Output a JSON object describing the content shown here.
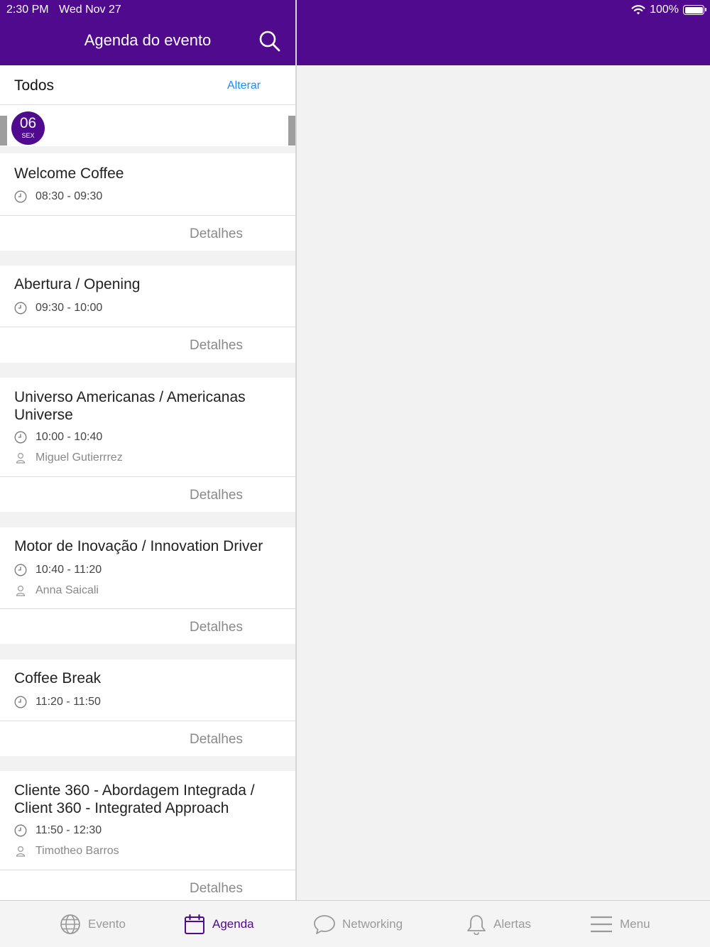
{
  "status_bar": {
    "time": "2:30 PM",
    "date": "Wed Nov 27",
    "battery": "100%"
  },
  "header": {
    "title": "Agenda do evento"
  },
  "filter": {
    "label": "Todos",
    "change_label": "Alterar"
  },
  "date_selector": {
    "day": "06",
    "weekday": "SEX"
  },
  "sessions": [
    {
      "title": "Welcome Coffee",
      "time": "08:30 - 09:30",
      "speaker": "",
      "details_label": "Detalhes"
    },
    {
      "title": "Abertura / Opening",
      "time": "09:30 - 10:00",
      "speaker": "",
      "details_label": "Detalhes"
    },
    {
      "title": "Universo Americanas / Americanas Universe",
      "time": "10:00 - 10:40",
      "speaker": "Miguel Gutierrrez",
      "details_label": "Detalhes"
    },
    {
      "title": "Motor de Inovação / Innovation Driver",
      "time": "10:40 - 11:20",
      "speaker": "Anna Saicali",
      "details_label": "Detalhes"
    },
    {
      "title": "Coffee Break",
      "time": "11:20 - 11:50",
      "speaker": "",
      "details_label": "Detalhes"
    },
    {
      "title": "Cliente 360 - Abordagem Integrada / Client 360 - Integrated Approach",
      "time": "11:50 - 12:30",
      "speaker": "Timotheo Barros",
      "details_label": "Detalhes"
    }
  ],
  "tabbar": {
    "items": [
      {
        "label": "Evento",
        "icon": "globe-icon"
      },
      {
        "label": "Agenda",
        "icon": "calendar-icon"
      },
      {
        "label": "Networking",
        "icon": "chat-bubble-icon"
      },
      {
        "label": "Alertas",
        "icon": "bell-icon"
      },
      {
        "label": "Menu",
        "icon": "menu-icon"
      }
    ],
    "active": "Agenda",
    "active_color": "#4f0a8e"
  },
  "colors": {
    "brand": "#4f0a8e",
    "link": "#1a8cff"
  }
}
